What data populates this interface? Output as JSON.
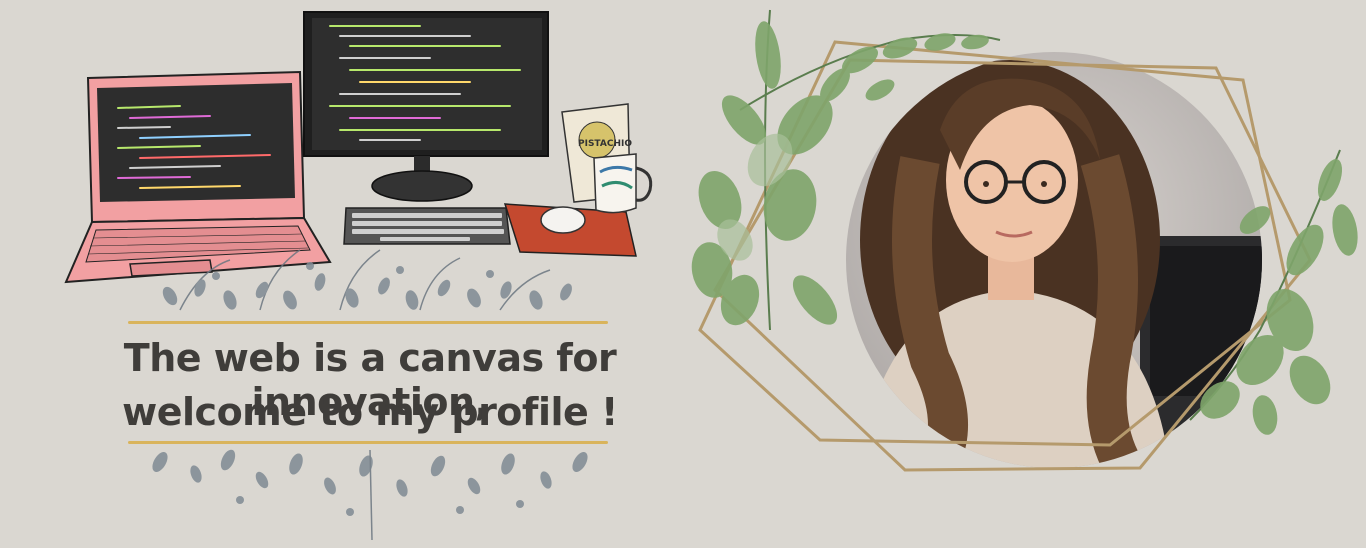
{
  "headline": {
    "line1": "The web is a canvas for innovation,",
    "line2": "welcome to my profile !"
  },
  "snack_bag_text": "PISTACHIO",
  "colors": {
    "background": "#dad7d1",
    "laptop": "#f2a0a2",
    "screen": "#2d2d2d",
    "mousepad": "#c4492f",
    "gold": "#d9b45c",
    "frame": "#b59a6c",
    "leaf_green": "#7fa56b",
    "foliage_gray": "#7f8a93"
  },
  "icons": [
    "laptop-icon",
    "monitor-icon",
    "keyboard-icon",
    "mouse-icon",
    "coffee-mug-icon",
    "snack-bag-icon",
    "portrait-photo",
    "leaf-decoration"
  ]
}
